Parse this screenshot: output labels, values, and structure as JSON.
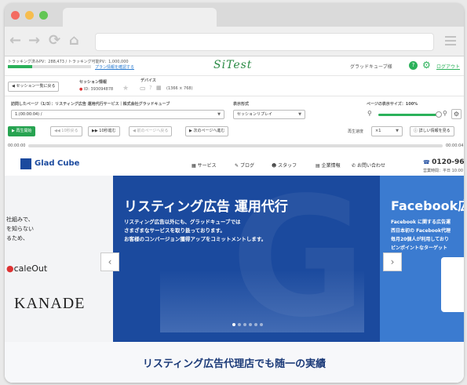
{
  "window": {
    "url": ""
  },
  "app": {
    "logo": "SiTest",
    "tracking_label": "トラッキング済みPV：288,473 / トラッキング可能PV：1,000,000",
    "plan_link": "プラン情報を確認する",
    "user": "グラッドキューブ様",
    "logout": "ログアウト",
    "back_to_list": "セッション一覧に戻る",
    "session_info_label": "セッション情報",
    "session_id": "ID: 393094878",
    "device_label": "デバイス",
    "device_size": "(1366 × 768)",
    "visited_page_label": "訪問したページ（1/3）：リスティング広告 運用代行サービス｜株式会社グラッドキューブ",
    "visited_page_value": "1.(00:00:04) /",
    "display_format_label": "表示形式",
    "display_format_value": "セッションリプレイ",
    "page_size_label": "ページの表示サイズ：100%",
    "play": "再生開始",
    "back10": "10秒戻る",
    "forward10": "10秒進む",
    "prev_page": "前のページへ戻る",
    "next_page": "次のページへ進む",
    "speed_label": "再生速度",
    "speed_value": "×1",
    "details_button": "詳しい情報を見る",
    "time_start": "00:00:00",
    "time_end": "00:00:04"
  },
  "site": {
    "logo": "Glad Cube",
    "nav": [
      "サービス",
      "ブログ",
      "スタッフ",
      "企業情報",
      "お問い合わせ"
    ],
    "phone": "0120-96-",
    "hours": "営業時間：平日 10:00",
    "left_text": [
      "社組みで、",
      "を知らない",
      "るため、"
    ],
    "left_logo1": "caleOut",
    "left_logo2": "KANADE",
    "main_title": "リスティング広告 運用代行",
    "main_body": [
      "リスティング広告以外にも、グラッドキューブでは",
      "さまざまなサービスを取り扱っております。",
      "お客様のコンバージョン獲得アップをコミットメントします。"
    ],
    "right_title": "Facebook広",
    "right_body": [
      "Facebook に関する広告運",
      "西日本初の Facebook代理",
      "毎月20個人が利用しており",
      "ピンポイントなターゲット"
    ],
    "bottom_heading": "リスティング広告代理店でも随一の実績"
  },
  "colors": {
    "accent": "#2bb15a",
    "brand_blue": "#1b4a9e"
  }
}
